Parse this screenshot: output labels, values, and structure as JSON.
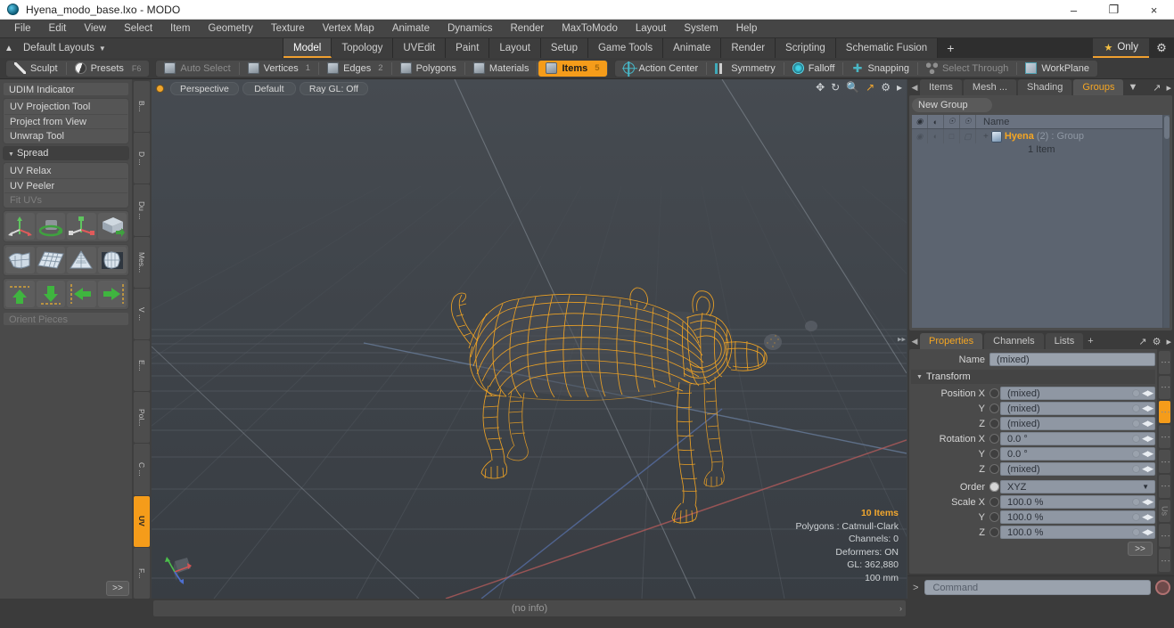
{
  "window": {
    "title": "Hyena_modo_base.lxo - MODO",
    "minimize": "–",
    "maximize": "❐",
    "close": "×"
  },
  "menubar": {
    "items": [
      "File",
      "Edit",
      "View",
      "Select",
      "Item",
      "Geometry",
      "Texture",
      "Vertex Map",
      "Animate",
      "Dynamics",
      "Render",
      "MaxToModo",
      "Layout",
      "System",
      "Help"
    ]
  },
  "layoutbar": {
    "default_layouts": "Default Layouts",
    "tabs": [
      "Model",
      "Topology",
      "UVEdit",
      "Paint",
      "Layout",
      "Setup",
      "Game Tools",
      "Animate",
      "Render",
      "Scripting",
      "Schematic Fusion"
    ],
    "active_tab": "Model",
    "add_tab": "+",
    "only_label": "Only"
  },
  "toolbar": {
    "group1": [
      {
        "label": "Sculpt",
        "icon": "brush-icon",
        "state": "normal",
        "hint": ""
      },
      {
        "label": "Presets",
        "icon": "presets-icon",
        "state": "normal",
        "hint": "F6"
      }
    ],
    "group2": [
      {
        "label": "Auto Select",
        "icon": "cube-icon",
        "state": "dim",
        "num": ""
      },
      {
        "label": "Vertices",
        "icon": "cube-icon",
        "state": "normal",
        "num": "1"
      },
      {
        "label": "Edges",
        "icon": "cube-icon",
        "state": "normal",
        "num": "2"
      },
      {
        "label": "Polygons",
        "icon": "cube-icon",
        "state": "normal",
        "num": ""
      },
      {
        "label": "Materials",
        "icon": "cube-icon",
        "state": "normal",
        "num": ""
      },
      {
        "label": "Items",
        "icon": "cube-icon",
        "state": "active",
        "num": "5"
      }
    ],
    "group3": [
      {
        "label": "Action Center",
        "icon": "action-center-icon",
        "state": "normal"
      },
      {
        "label": "Symmetry",
        "icon": "symmetry-icon",
        "state": "normal"
      },
      {
        "label": "Falloff",
        "icon": "falloff-icon",
        "state": "normal"
      },
      {
        "label": "Snapping",
        "icon": "snapping-icon",
        "state": "normal"
      },
      {
        "label": "Select Through",
        "icon": "select-through-icon",
        "state": "dim"
      },
      {
        "label": "WorkPlane",
        "icon": "workplane-icon",
        "state": "normal"
      }
    ]
  },
  "left_panel": {
    "items_top": [
      "UDIM Indicator"
    ],
    "group_a": [
      "UV Projection Tool",
      "Project from View",
      "Unwrap Tool"
    ],
    "spread_header": "Spread",
    "group_b": [
      "UV Relax",
      "UV Peeler"
    ],
    "fit_uvs": "Fit UVs",
    "orient_pieces": "Orient Pieces",
    "expand_button": ">>",
    "icon_rows": [
      [
        "move-axis-icon",
        "rotate-icon",
        "scale-axis-icon",
        "drop-to-floor-icon"
      ],
      [
        "uv-peel-icon",
        "uv-grid-icon",
        "uv-cone-icon",
        "uv-relax-icon"
      ],
      [
        "align-up-icon",
        "align-down-icon",
        "align-left-icon",
        "align-right-icon"
      ]
    ],
    "vtabs": [
      "B...",
      "D ...",
      "Du ...",
      "Mes...",
      "V ...",
      "E...",
      "Pol...",
      "C ...",
      "UV",
      "F..."
    ],
    "vtab_active": "UV"
  },
  "viewport": {
    "view_mode": "Perspective",
    "shading": "Default",
    "raygl": "Ray GL: Off",
    "tool_icons": [
      "pan-icon",
      "rotate-icon",
      "zoom-icon",
      "fit-icon",
      "gear-icon",
      "chevron-right-icon"
    ],
    "info": {
      "items": "10 Items",
      "polygons": "Polygons : Catmull-Clark",
      "channels": "Channels: 0",
      "deformers": "Deformers: ON",
      "gl": "GL: 362,880",
      "scale": "100 mm"
    },
    "model_color": "#f5a623"
  },
  "right_panel": {
    "top_tabs": [
      "Items",
      "Mesh ...",
      "Shading",
      "Groups"
    ],
    "top_tabs_active": "Groups",
    "new_group_button": "New Group",
    "tree": {
      "col_header_icons": [
        "eye-icon",
        "render-icon",
        "lock-icon",
        "select-icon"
      ],
      "name_header": "Name",
      "row": {
        "name": "Hyena",
        "count": "(2)",
        "type": ": Group",
        "sub": "1 Item",
        "expand": "+"
      }
    },
    "prop_tabs": [
      "Properties",
      "Channels",
      "Lists"
    ],
    "prop_tabs_active": "Properties",
    "prop_add": "+",
    "properties": {
      "name_label": "Name",
      "name_value": "(mixed)",
      "transform_section": "Transform",
      "rows": [
        {
          "label": "Position X",
          "value": "(mixed)"
        },
        {
          "label": "Y",
          "value": "(mixed)"
        },
        {
          "label": "Z",
          "value": "(mixed)"
        },
        {
          "label": "Rotation X",
          "value": "0.0 °"
        },
        {
          "label": "Y",
          "value": "0.0 °"
        },
        {
          "label": "Z",
          "value": "(mixed)"
        },
        {
          "label": "Order",
          "value": "XYZ",
          "type": "select"
        },
        {
          "label": "Scale X",
          "value": "100.0 %"
        },
        {
          "label": "Y",
          "value": "100.0 %"
        },
        {
          "label": "Z",
          "value": "100.0 %"
        }
      ],
      "expand_button": ">>"
    },
    "side_tabs": [
      "",
      "",
      "",
      "",
      "",
      "",
      "Us",
      "",
      ""
    ],
    "side_tab_active_index": 2
  },
  "command_bar": {
    "prompt": ">",
    "placeholder": "Command",
    "record_icon": "record-icon"
  },
  "status_bar": {
    "text": "(no info)",
    "arrow": "›"
  }
}
